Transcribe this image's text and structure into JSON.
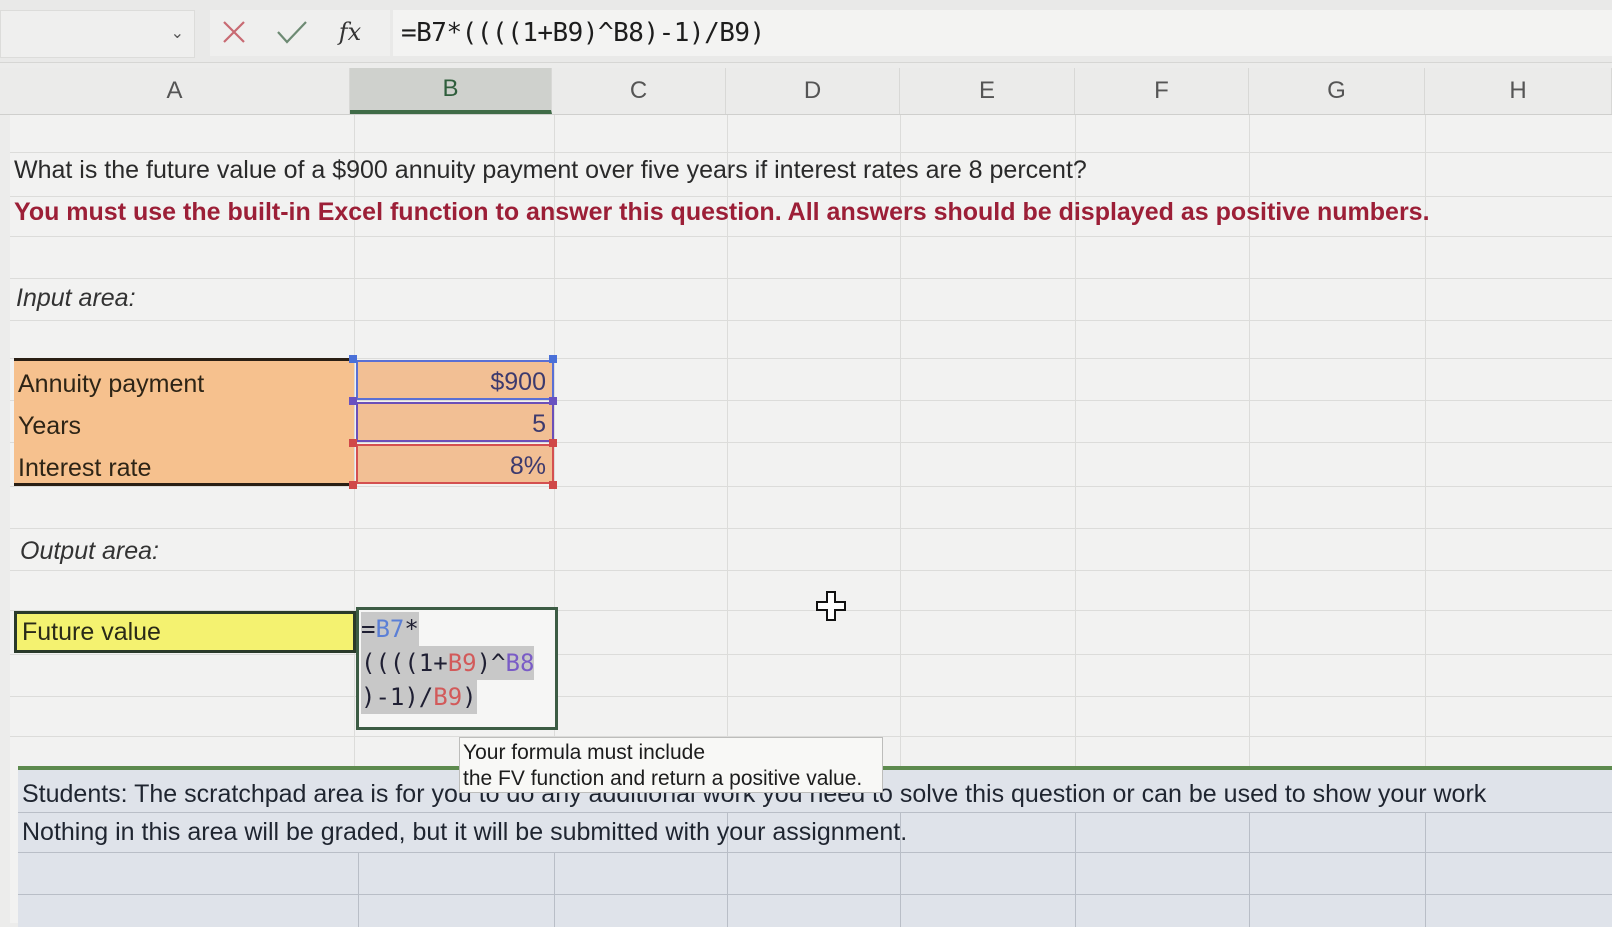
{
  "formula_bar": {
    "name_box_dropdown_icon": "chevron-down-icon",
    "cancel_icon": "x-icon",
    "enter_icon": "checkmark-icon",
    "function_icon": "fx",
    "formula": "=B7*((((1+B9)^B8)-1)/B9)"
  },
  "columns": [
    "A",
    "B",
    "C",
    "D",
    "E",
    "F",
    "G",
    "H"
  ],
  "selected_column": "B",
  "sheet": {
    "question": "What is the future value of a $900 annuity payment over five years if interest rates are 8 percent?",
    "instruction": "You must use the built-in Excel function to answer this question. All answers should be displayed as positive numbers.",
    "input_area_label": "Input area:",
    "inputs": [
      {
        "label": "Annuity payment",
        "value": "$900",
        "ref_color": "#5a6fd4"
      },
      {
        "label": "Years",
        "value": "5",
        "ref_color": "#6c4fb8"
      },
      {
        "label": "Interest rate",
        "value": "8%",
        "ref_color": "#d45050"
      }
    ],
    "output_area_label": "Output area:",
    "output": {
      "label": "Future value",
      "edit_line1_eq": "=",
      "edit_line1_ref": "B7",
      "edit_line1_rest": "*",
      "edit_line2_a": "((((1+",
      "edit_line2_ref1": "B9",
      "edit_line2_b": ")^",
      "edit_line2_ref2": "B8",
      "edit_line3_a": ")-1)/",
      "edit_line3_ref": "B9",
      "edit_line3_b": ")"
    },
    "tooltip": {
      "line1": "Your formula must include",
      "line2": "the FV function and return a positive value."
    },
    "scratchpad": {
      "line1": "Students: The scratchpad area is for you to do any additional work you need to solve this question or can be used to show your work",
      "line2": "Nothing in this area will be graded, but it will be submitted with your assignment."
    }
  },
  "colors": {
    "instruction_red": "#9c1f37",
    "input_fill": "#f6c18e",
    "output_fill": "#f4f270",
    "scratch_fill": "#dfe3ea",
    "header_selected": "#3f6b47"
  }
}
